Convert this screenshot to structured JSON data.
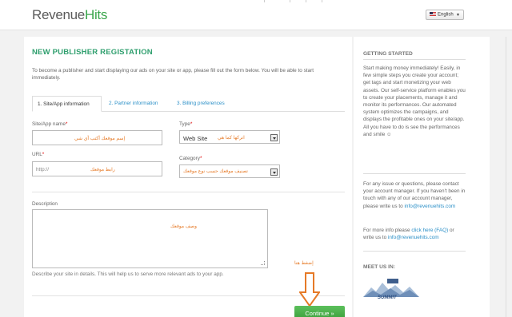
{
  "header": {
    "logo_part1": "Rev",
    "logo_part2": "enue",
    "logo_part3": "Hits",
    "logo_e": "e",
    "language": "English"
  },
  "form": {
    "title": "NEW PUBLISHER REGISTATION",
    "intro": "To become a publisher and start displaying our ads on your site or app, please fill out the form below. You will be able to start immediately.",
    "tabs": [
      "1. Site/App information",
      "2. Partner information",
      "3. Billing preferences"
    ],
    "site_name_label": "Site/App name",
    "site_name_annotation": "إسم موقعك أكتب أي شي",
    "type_label": "Type",
    "type_value": "Web Site",
    "type_annotation": "اتركها كما هي",
    "url_label": "URL",
    "url_placeholder": "http://",
    "url_annotation": "رابط موقعك",
    "category_label": "Category",
    "category_annotation": "تصنيف موقعك حسب نوع موقعك",
    "required_mark": "*",
    "description_label": "Description",
    "description_annotation": "وصف موقعك",
    "description_hint": "Describe your site in details. This will help us to serve more relevant ads to your app.",
    "continue_annotation": "إضغط هنا",
    "continue_label": "Continue »"
  },
  "sidebar": {
    "getting_started_title": "GETTING STARTED",
    "getting_started_text": "Start making money immediately! Easily, in few simple steps you create your account; get tags and start monetizing your web assets. Our self-service platform enables you to create your placements, manage it and monitor its performances. Our automated system optimizes the campaigns, and displays the profitable ones on your site/app. All you have to do is see the performances and smile ☺",
    "contact_text": "For any issue or questions, please contact your account manager. If you haven't been in touch with any of our account manager, please write us to",
    "contact_email": "info@revenuehits.com",
    "faq_prefix": "For more info please",
    "faq_link": "click here (FAQ)",
    "faq_middle": "or write us to",
    "faq_email": "info@revenuehits.com",
    "meet_us_title": "MEET US IN:",
    "event_logo_text": "SUMMIT"
  },
  "colors": {
    "brand_green": "#3aa64b",
    "title_green": "#2f9f6e",
    "link_blue": "#2a8fc7",
    "annotation_orange": "#e67a27",
    "button_green": "#4bb04b"
  }
}
